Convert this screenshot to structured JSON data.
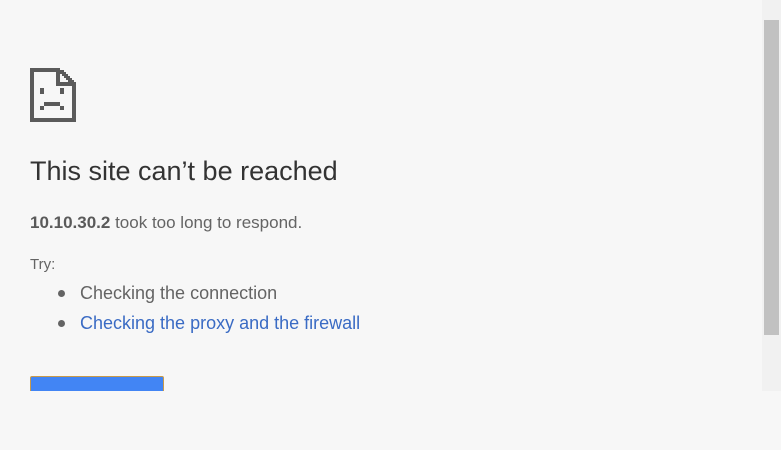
{
  "error": {
    "icon": "sad-document-icon",
    "title": "This site can’t be reached",
    "host": "10.10.30.2",
    "message": " took too long to respond.",
    "try_label": "Try:",
    "suggestions": [
      "Checking the connection",
      "Checking the proxy and the firewall"
    ]
  },
  "colors": {
    "background": "#f7f7f7",
    "title_text": "#333333",
    "body_text": "#646464",
    "link": "#3a6bc4",
    "button": "#4285f4"
  }
}
